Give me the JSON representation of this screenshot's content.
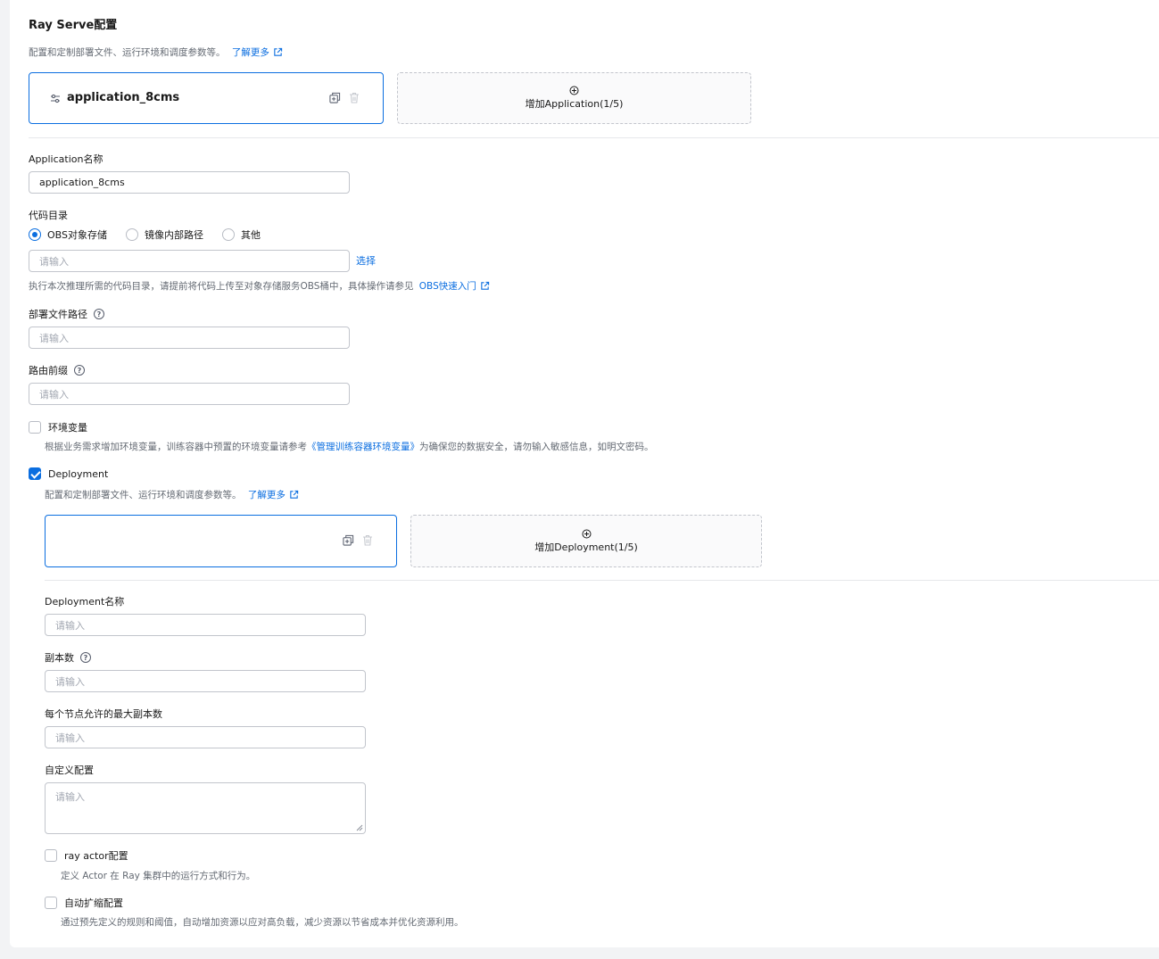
{
  "section": {
    "title": "Ray Serve配置",
    "desc": "配置和定制部署文件、运行环境和调度参数等。",
    "learn_more": "了解更多"
  },
  "application_tab": {
    "name": "application_8cms",
    "add_label": "增加Application(1/5)"
  },
  "app_form": {
    "name_label": "Application名称",
    "name_value": "application_8cms",
    "code_dir_label": "代码目录",
    "radio_options": [
      "OBS对象存储",
      "镜像内部路径",
      "其他"
    ],
    "radio_selected": "OBS对象存储",
    "code_dir_placeholder": "请输入",
    "select_link": "选择",
    "code_dir_hint": "执行本次推理所需的代码目录，请提前将代码上传至对象存储服务OBS桶中，具体操作请参见",
    "obs_link": "OBS快速入门",
    "deploy_file_label": "部署文件路径",
    "deploy_file_placeholder": "请输入",
    "route_prefix_label": "路由前缀",
    "route_prefix_placeholder": "请输入",
    "env_label": "环境变量",
    "env_checked": false,
    "env_hint_pre": "根据业务需求增加环境变量，训练容器中预置的环境变量请参考",
    "env_hint_link": "《管理训练容器环境变量》",
    "env_hint_post": "为确保您的数据安全，请勿输入敏感信息，如明文密码。",
    "deployment_label": "Deployment",
    "deployment_checked": true,
    "deployment_desc": "配置和定制部署文件、运行环境和调度参数等。",
    "deployment_learn_more": "了解更多"
  },
  "deployment_tab": {
    "add_label": "增加Deployment(1/5)"
  },
  "deploy_form": {
    "name_label": "Deployment名称",
    "name_placeholder": "请输入",
    "replicas_label": "副本数",
    "replicas_placeholder": "请输入",
    "max_per_node_label": "每个节点允许的最大副本数",
    "max_per_node_placeholder": "请输入",
    "custom_config_label": "自定义配置",
    "custom_config_placeholder": "请输入",
    "ray_actor_label": "ray actor配置",
    "ray_actor_checked": false,
    "ray_actor_hint": "定义 Actor 在 Ray 集群中的运行方式和行为。",
    "autoscale_label": "自动扩缩配置",
    "autoscale_checked": false,
    "autoscale_hint": "通过预先定义的规则和阈值，自动增加资源以应对高负载，减少资源以节省成本并优化资源利用。"
  },
  "colors": {
    "accent": "#0b6ee0",
    "text": "#191919",
    "muted": "#646a73",
    "border": "#c2c5cc"
  }
}
